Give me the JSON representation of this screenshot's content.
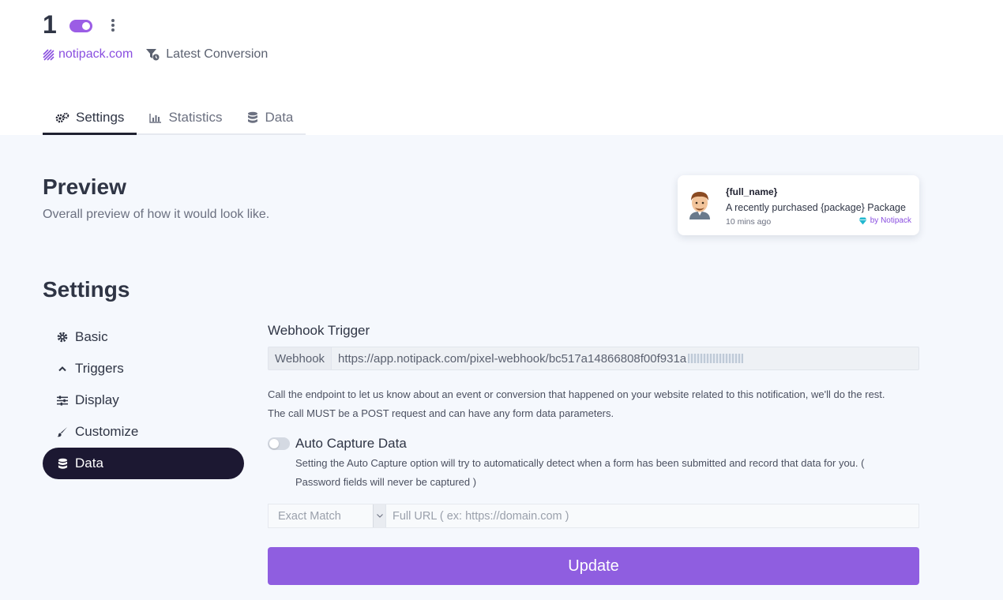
{
  "header": {
    "title": "1",
    "domain": "notipack.com",
    "type": "Latest Conversion",
    "toggle_enabled": true
  },
  "tabs": [
    {
      "label": "Settings",
      "icon": "gears-icon",
      "active": true
    },
    {
      "label": "Statistics",
      "icon": "bar-chart-icon",
      "active": false
    },
    {
      "label": "Data",
      "icon": "database-icon",
      "active": false
    }
  ],
  "preview": {
    "title": "Preview",
    "subtitle": "Overall preview of how it would look like.",
    "notification": {
      "name": "{full_name}",
      "text": "A recently purchased {package} Package",
      "time": "10 mins ago",
      "by": "by Notipack"
    }
  },
  "settings": {
    "title": "Settings",
    "sidebar": [
      {
        "label": "Basic",
        "icon": "gear-icon",
        "active": false
      },
      {
        "label": "Triggers",
        "icon": "chevron-up-icon",
        "active": false
      },
      {
        "label": "Display",
        "icon": "sliders-icon",
        "active": false
      },
      {
        "label": "Customize",
        "icon": "brush-icon",
        "active": false
      },
      {
        "label": "Data",
        "icon": "database-icon",
        "active": true
      }
    ],
    "webhook": {
      "label": "Webhook Trigger",
      "prefix": "Webhook",
      "url": "https://app.notipack.com/pixel-webhook/bc517a14866808f00f931a",
      "description_1": "Call the endpoint to let us know about an event or conversion that happened on your website related to this notification, we'll do the rest.",
      "description_2": "The call MUST be a POST request and can have any form data parameters."
    },
    "auto_capture": {
      "label": "Auto Capture Data",
      "enabled": false,
      "description": "Setting the Auto Capture option will try to automatically detect when a form has been submitted and record that data for you. ( Password fields will never be captured )"
    },
    "match": {
      "selected": "Exact Match",
      "placeholder": "Full URL ( ex: https://domain.com )"
    },
    "update_label": "Update"
  },
  "colors": {
    "accent": "#8f5ee0",
    "sidebar_active": "#1c1832",
    "background": "#f5f8fd"
  }
}
